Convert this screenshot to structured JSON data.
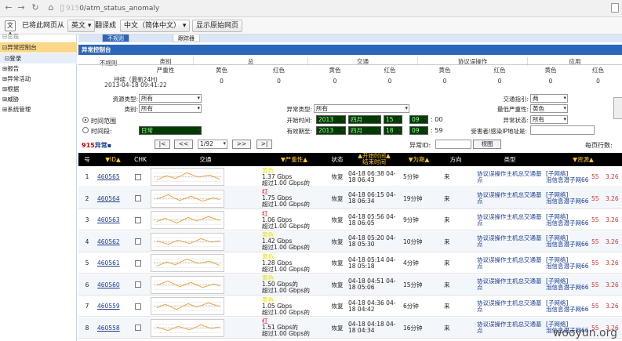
{
  "browser": {
    "url_prefix": "\u0007 ",
    "url_host_hidden": "915",
    "url_path": "0/atm_status_anomaly"
  },
  "translate": {
    "prefix": "已将此网页从",
    "lang_from": "英文",
    "translate_label": "翻译成",
    "lang_to": "中文（简体中文）",
    "show_original": "显示原始网页"
  },
  "sidebar": {
    "items": [
      "总揽",
      "异常控制台",
      "登录",
      "报告",
      "异常活动",
      "根据",
      "威胁",
      "系统管理"
    ]
  },
  "tabs": [
    "不规则",
    "跟踪器"
  ],
  "panel_title": "异常控制台",
  "summary": {
    "col0": "不规则",
    "groups": [
      "类别",
      "总",
      "交通",
      "协议误操作",
      "应用"
    ],
    "sub": [
      "严重性",
      "黄色",
      "红色",
      "黄色",
      "红色",
      "黄色",
      "红色",
      "黄色",
      "红色"
    ],
    "row_label": "持续（最新24H)",
    "row_time": "2013-04-18 09:41:22",
    "values": [
      "0",
      "0",
      "0",
      "0",
      "0",
      "0",
      "0",
      "0"
    ]
  },
  "filters": {
    "resource_type_label": "资源类型:",
    "resource_type": "所有",
    "category_label": "类别:",
    "category": "所有",
    "anomaly_type_label": "异常类型:",
    "anomaly_type": "所有",
    "direction_label": "交通指引:",
    "direction": "两",
    "min_sev_label": "最低严重性:",
    "min_sev": "黄色",
    "state_label": "异常状态:",
    "state": "所有",
    "time_range_label": "时间范围",
    "time_period_label": "时间段:",
    "time_period": "日常",
    "start_label": "开始时间:",
    "start_year": "2013",
    "start_month": "四月",
    "start_day": "15",
    "start_hour": "09",
    "start_sec": "00",
    "end_label": "有效期至:",
    "end_year": "2013",
    "end_month": "四月",
    "end_day": "18",
    "end_hour": "09",
    "end_sec": "59",
    "victim_label": "受害者/感染IP地址是:"
  },
  "pager": {
    "count": "915",
    "count_suffix": "异常▪",
    "first": "|<",
    "prev": "<<",
    "page": "1/92",
    "next": ">>",
    "last": ">|",
    "id_label": "异常ID:",
    "view": "视图",
    "per_page_label": "每页行数:"
  },
  "table": {
    "headers": [
      "号",
      "▼ID▲",
      "CHK",
      "交通",
      "▼严重性▲",
      "状态",
      "▲开始时间▲\n结束时间",
      "▼为期▲",
      "方向",
      "类型",
      "▼资源▲"
    ],
    "rows": [
      {
        "n": "1",
        "id": "460565",
        "sev_color": "黄色",
        "rate": "1.37 Gbps",
        "over": "超过1.00 Gbps的",
        "state": "恢复",
        "start": "04-18 06:38 04-",
        "end": "18 06:43",
        "dur": "5分钟",
        "dir": "来",
        "type": "协议误操作主机总交通基点",
        "res": "[子网络]\n泡信息潜子网66",
        "v1": "55",
        "v2": "3.26"
      },
      {
        "n": "2",
        "id": "460564",
        "sev_color": "红",
        "rate": "1.75 Gbps",
        "over": "超过1.00 Gbps的",
        "state": "恢复",
        "start": "04-18 06:15 04-",
        "end": "18 06:34",
        "dur": "19分钟",
        "dir": "来",
        "type": "协议误操作主机总交通基点",
        "res": "[子网络]\n泡信息潜子网66",
        "v1": "55",
        "v2": "3.26"
      },
      {
        "n": "3",
        "id": "460563",
        "sev_color": "红",
        "rate": "1.06 Gbps",
        "over": "超过1.00 Gbps的",
        "state": "恢复",
        "start": "04-18 05:56 04-",
        "end": "18 06:05",
        "dur": "9分钟",
        "dir": "来",
        "type": "协议误操作主机总交通基点",
        "res": "[子网络]\n泡信息潜子网66",
        "v1": "55",
        "v2": "3.26"
      },
      {
        "n": "4",
        "id": "460562",
        "sev_color": "黄色",
        "rate": "1.42 Gbps",
        "over": "超过1.00 Gbps的",
        "state": "恢复",
        "start": "04-18 05:20 04-",
        "end": "18 05:30",
        "dur": "10分钟",
        "dir": "来",
        "type": "协议误操作主机总交通基点",
        "res": "[子网络]\n泡信息潜子网66",
        "v1": "55",
        "v2": "3.26"
      },
      {
        "n": "5",
        "id": "460561",
        "sev_color": "黄色",
        "rate": "1.28 Gbps",
        "over": "超过1.00 Gbps的",
        "state": "恢复",
        "start": "04-18 05:14 04-",
        "end": "18 05:18",
        "dur": "4分钟",
        "dir": "来",
        "type": "协议误操作主机总交通基点",
        "res": "[子网络]\n泡信息潜子网66",
        "v1": "55",
        "v2": "3.26"
      },
      {
        "n": "6",
        "id": "460560",
        "sev_color": "黄色",
        "rate": "1.50 Gbps的",
        "over": "超过1.00 Gbps的",
        "state": "恢复",
        "start": "04-18 04:51 04-",
        "end": "18 05:06",
        "dur": "15分钟",
        "dir": "来",
        "type": "协议误操作主机总交通基点",
        "res": "[子网络]\n泡信息潜子网66",
        "v1": "55",
        "v2": "3.26"
      },
      {
        "n": "7",
        "id": "460559",
        "sev_color": "黄色",
        "rate": "1.05 Gbps",
        "over": "超过1.00 Gbps的",
        "state": "恢复",
        "start": "04-18 04:36 04-",
        "end": "18 04:42",
        "dur": "6分钟",
        "dir": "来",
        "type": "协议误操作主机总交通基点",
        "res": "[子网络]\n泡信息潜子网66",
        "v1": "55",
        "v2": "3.26"
      },
      {
        "n": "8",
        "id": "460558",
        "sev_color": "红",
        "rate": "1.51 Gbps的",
        "over": "超过1.00 Gbps的",
        "state": "恢复",
        "start": "04-18 04:18 04-",
        "end": "18 04:34",
        "dur": "16分钟",
        "dir": "来",
        "type": "协议误操作主机总交通基点",
        "res": "[子网络]\n泡信息潜子网66",
        "v1": "55",
        "v2": "3.26"
      }
    ]
  },
  "watermark": "wooyun.org"
}
